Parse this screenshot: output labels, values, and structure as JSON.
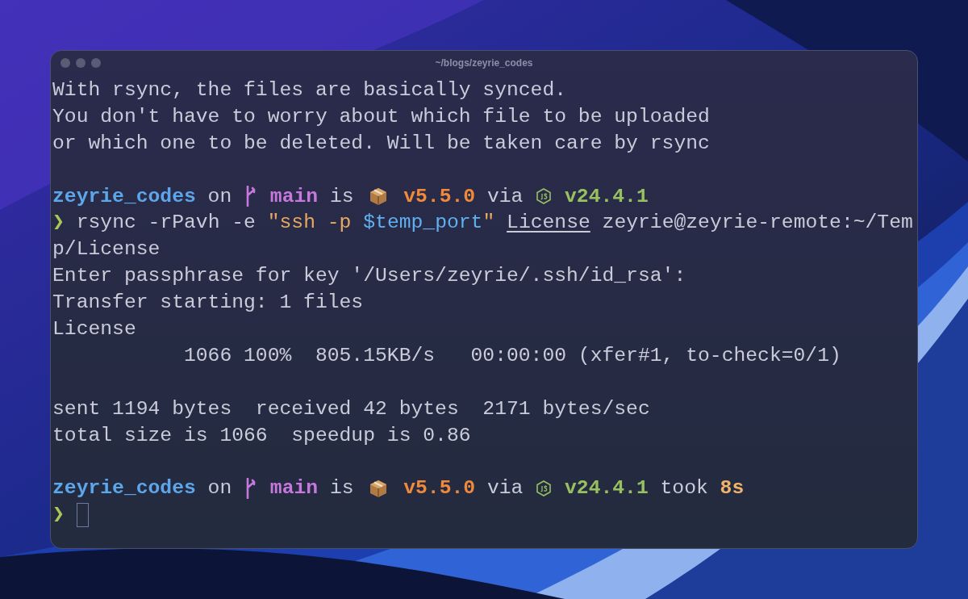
{
  "window": {
    "title": "~/blogs/zeyrie_codes"
  },
  "terminal": {
    "lines": [
      {
        "kind": "output",
        "text": "With rsync, the files are basically synced."
      },
      {
        "kind": "output",
        "text": "You don't have to worry about which file to be uploaded"
      },
      {
        "kind": "output",
        "text": "or which one to be deleted. Will be taken care by rsync"
      },
      {
        "kind": "blank"
      },
      {
        "kind": "prompt_info",
        "segments": [
          {
            "kind": "dir",
            "text": "zeyrie_codes"
          },
          {
            "kind": "plain",
            "text": " on "
          },
          {
            "kind": "git_icon"
          },
          {
            "kind": "branch",
            "text": " main"
          },
          {
            "kind": "plain",
            "text": " is "
          },
          {
            "kind": "package_icon"
          },
          {
            "kind": "version",
            "text": " v5.5.0"
          },
          {
            "kind": "plain",
            "text": " via "
          },
          {
            "kind": "node_icon"
          },
          {
            "kind": "node",
            "text": " v24.4.1"
          }
        ]
      },
      {
        "kind": "command",
        "segments": [
          {
            "kind": "prompt",
            "text": "❯"
          },
          {
            "kind": "plain",
            "text": " rsync -rPavh -e "
          },
          {
            "kind": "string",
            "text": "\"ssh -p "
          },
          {
            "kind": "var",
            "text": "$temp_port"
          },
          {
            "kind": "string",
            "text": "\" "
          },
          {
            "kind": "path",
            "text": "License"
          },
          {
            "kind": "plain",
            "text": " zeyrie@zeyrie-remote:~/Tem"
          }
        ]
      },
      {
        "kind": "output",
        "text": "p/License"
      },
      {
        "kind": "output",
        "text": "Enter passphrase for key '/Users/zeyrie/.ssh/id_rsa':"
      },
      {
        "kind": "output",
        "text": "Transfer starting: 1 files"
      },
      {
        "kind": "output",
        "text": "License"
      },
      {
        "kind": "output",
        "text": "           1066 100%  805.15KB/s   00:00:00 (xfer#1, to-check=0/1)"
      },
      {
        "kind": "blank"
      },
      {
        "kind": "output",
        "text": "sent 1194 bytes  received 42 bytes  2171 bytes/sec"
      },
      {
        "kind": "output",
        "text": "total size is 1066  speedup is 0.86"
      },
      {
        "kind": "blank"
      },
      {
        "kind": "prompt_info",
        "segments": [
          {
            "kind": "dir",
            "text": "zeyrie_codes"
          },
          {
            "kind": "plain",
            "text": " on "
          },
          {
            "kind": "git_icon"
          },
          {
            "kind": "branch",
            "text": " main"
          },
          {
            "kind": "plain",
            "text": " is "
          },
          {
            "kind": "package_icon"
          },
          {
            "kind": "version",
            "text": " v5.5.0"
          },
          {
            "kind": "plain",
            "text": " via "
          },
          {
            "kind": "node_icon"
          },
          {
            "kind": "node",
            "text": " v24.4.1"
          },
          {
            "kind": "plain",
            "text": " took "
          },
          {
            "kind": "duration",
            "text": "8s"
          }
        ]
      },
      {
        "kind": "command",
        "segments": [
          {
            "kind": "prompt",
            "text": "❯"
          },
          {
            "kind": "cursor"
          }
        ]
      }
    ]
  }
}
